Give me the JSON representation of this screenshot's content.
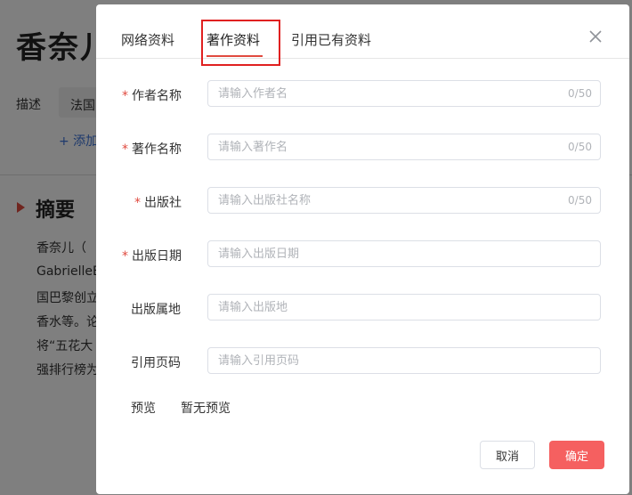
{
  "background": {
    "title": "香奈儿",
    "desc_label": "描述",
    "desc_value": "法国",
    "add_link": "+ 添加",
    "summary_heading": "摘要",
    "summary_lines": [
      "香奈儿（",
      "GabrielleB",
      "国巴黎创立",
      "香水等。论",
      "将“五花大",
      "强排行榜为"
    ]
  },
  "dialog": {
    "tabs": [
      {
        "label": "网络资料",
        "active": false
      },
      {
        "label": "著作资料",
        "active": true
      },
      {
        "label": "引用已有资料",
        "active": false
      }
    ],
    "close_icon": "close-icon",
    "fields": [
      {
        "label": "作者名称",
        "required": true,
        "placeholder": "请输入作者名",
        "value": "",
        "counter": "0/50"
      },
      {
        "label": "著作名称",
        "required": true,
        "placeholder": "请输入著作名",
        "value": "",
        "counter": "0/50"
      },
      {
        "label": "出版社",
        "required": true,
        "placeholder": "请输入出版社名称",
        "value": "",
        "counter": "0/50"
      },
      {
        "label": "出版日期",
        "required": true,
        "placeholder": "请输入出版日期",
        "value": ""
      },
      {
        "label": "出版属地",
        "required": false,
        "placeholder": "请输入出版地",
        "value": ""
      },
      {
        "label": "引用页码",
        "required": false,
        "placeholder": "请输入引用页码",
        "value": ""
      }
    ],
    "preview_label": "预览",
    "preview_value": "暂无预览",
    "cancel_label": "取消",
    "ok_label": "确定"
  },
  "colors": {
    "accent": "#e04a3f",
    "ok_button": "#f56060",
    "highlight_box": "#e02020",
    "link": "#3b73d9"
  }
}
